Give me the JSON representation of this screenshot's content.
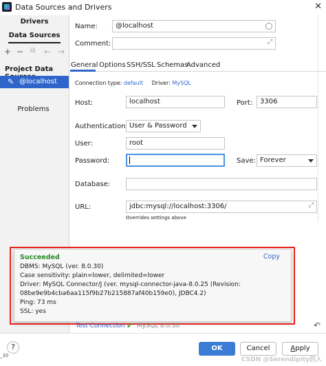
{
  "window": {
    "title": "Data Sources and Drivers",
    "close": "✕"
  },
  "left_panel": {
    "tab_drivers": "Drivers",
    "tab_data_sources": "Data Sources",
    "toolbar": {
      "add": "+",
      "remove": "−",
      "duplicate": "⧉",
      "back": "←",
      "forward": "→"
    },
    "section_label": "Project Data Sources",
    "selected_item": "@localhost",
    "problems": "Problems"
  },
  "form": {
    "name_label": "Name:",
    "name_value": "@localhost",
    "comment_label": "Comment:",
    "comment_value": "",
    "tabs": [
      "General",
      "Options",
      "SSH/SSL",
      "Schemas",
      "Advanced"
    ],
    "conn_type_label": "Connection type:",
    "conn_type_value": "default",
    "driver_label": "Driver:",
    "driver_value": "MySQL",
    "host_label": "Host:",
    "host_value": "localhost",
    "port_label": "Port:",
    "port_value": "3306",
    "auth_label": "Authentication:",
    "auth_value": "User & Password",
    "user_label": "User:",
    "user_value": "root",
    "password_label": "Password:",
    "password_value": "",
    "save_label": "Save:",
    "save_value": "Forever",
    "database_label": "Database:",
    "database_value": "",
    "url_label": "URL:",
    "url_value": "jdbc:mysql://localhost:3306/",
    "url_note": "Overrides settings above"
  },
  "popup": {
    "title": "Succeeded",
    "copy": "Copy",
    "lines": [
      "DBMS: MySQL (ver. 8.0.30)",
      "Case sensitivity: plain=lower, delimited=lower",
      "Driver: MySQL Connector/J (ver. mysql-connector-java-8.0.25 (Revision:",
      "08be9e9b4cba6aa115f9b27b215887af40b159e0), JDBC4.2)",
      "Ping: 73 ms",
      "SSL: yes"
    ]
  },
  "test_connection": {
    "label": "Test Connection",
    "version": "MySQL 8.0.30",
    "reset": "↶"
  },
  "footer": {
    "help": "?",
    "ok": "OK",
    "cancel": "Cancel",
    "apply_mnemonic": "A",
    "apply_rest": "pply",
    "left_edge_text": "_30",
    "watermark": "CSDN @Serendipity的人"
  }
}
